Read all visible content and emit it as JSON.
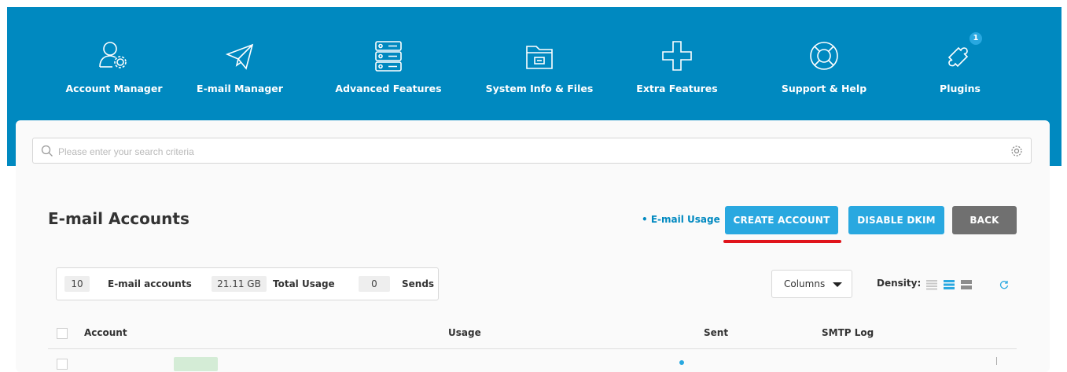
{
  "nav": {
    "items": [
      {
        "label": "Account Manager",
        "icon": "account-manager-icon"
      },
      {
        "label": "E-mail Manager",
        "icon": "paper-plane-icon"
      },
      {
        "label": "Advanced Features",
        "icon": "server-icon"
      },
      {
        "label": "System Info & Files",
        "icon": "folder-icon"
      },
      {
        "label": "Extra Features",
        "icon": "plus-icon"
      },
      {
        "label": "Support & Help",
        "icon": "lifebuoy-icon"
      },
      {
        "label": "Plugins",
        "icon": "puzzle-icon",
        "badge": "1"
      }
    ]
  },
  "search": {
    "placeholder": "Please enter your search criteria"
  },
  "page": {
    "title": "E-mail Accounts"
  },
  "actions": {
    "usage_link": "• E-mail Usage",
    "create": "CREATE ACCOUNT",
    "disable_dkim": "DISABLE DKIM",
    "back": "BACK"
  },
  "stats": {
    "accounts_count": "10",
    "accounts_label": "E-mail accounts",
    "usage_value": "21.11 GB",
    "usage_label": "Total Usage",
    "sends_value": "0",
    "sends_label": "Sends"
  },
  "toolbar": {
    "columns_label": "Columns",
    "density_label": "Density:"
  },
  "table": {
    "headers": [
      "Account",
      "Usage",
      "Sent",
      "SMTP Log"
    ]
  },
  "colors": {
    "brand": "#0089c0",
    "accent": "#29a8e0",
    "back": "#707070",
    "highlight": "#e0141b"
  }
}
